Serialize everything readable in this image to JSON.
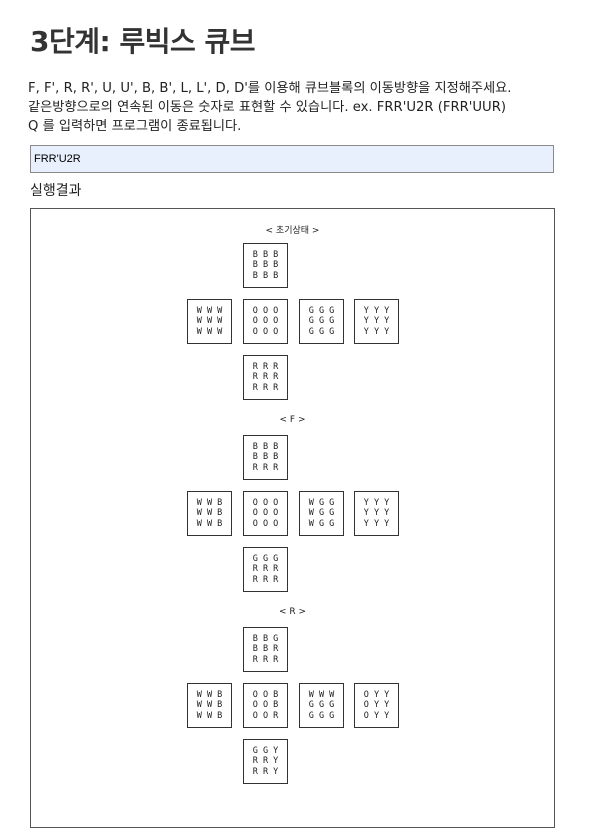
{
  "page": {
    "title": "3단계: 루빅스 큐브",
    "description_lines": [
      " F, F', R, R', U, U', B, B', L, L', D, D'를 이용해 큐브블록의 이동방향을 지정해주세요.",
      "같은방향으로의 연속된 이동은 숫자로 표현할 수 있습니다. ex. FRR'U2R (FRR'UUR)",
      "Q 를 입력하면 프로그램이 종료됩니다."
    ],
    "input_value": "FRR'U2R",
    "result_label": "실행결과"
  },
  "steps": [
    {
      "label": "< 초기상태 >",
      "up": [
        "B B B",
        "B B B",
        "B B B"
      ],
      "left": [
        "W W W",
        "W W W",
        "W W W"
      ],
      "front": [
        "O O O",
        "O O O",
        "O O O"
      ],
      "right": [
        "G G G",
        "G G G",
        "G G G"
      ],
      "back": [
        "Y Y Y",
        "Y Y Y",
        "Y Y Y"
      ],
      "down": [
        "R R R",
        "R R R",
        "R R R"
      ]
    },
    {
      "label": "< F >",
      "up": [
        "B B B",
        "B B B",
        "R R R"
      ],
      "left": [
        "W W B",
        "W W B",
        "W W B"
      ],
      "front": [
        "O O O",
        "O O O",
        "O O O"
      ],
      "right": [
        "W G G",
        "W G G",
        "W G G"
      ],
      "back": [
        "Y Y Y",
        "Y Y Y",
        "Y Y Y"
      ],
      "down": [
        "G G G",
        "R R R",
        "R R R"
      ]
    },
    {
      "label": "< R >",
      "up": [
        "B B G",
        "B B R",
        "R R R"
      ],
      "left": [
        "W W B",
        "W W B",
        "W W B"
      ],
      "front": [
        "O O B",
        "O O B",
        "O O R"
      ],
      "right": [
        "W W W",
        "G G G",
        "G G G"
      ],
      "back": [
        "O Y Y",
        "O Y Y",
        "O Y Y"
      ],
      "down": [
        "G G Y",
        "R R Y",
        "R R Y"
      ]
    }
  ]
}
